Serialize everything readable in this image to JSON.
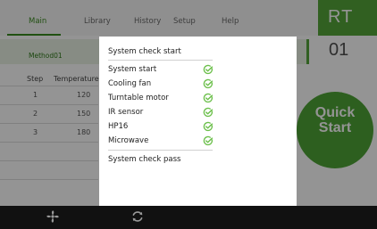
{
  "tabs": [
    {
      "label": "Main",
      "active": true
    },
    {
      "label": "Library",
      "active": false
    },
    {
      "label": "History",
      "active": false
    },
    {
      "label": "Setup",
      "active": false
    },
    {
      "label": "Help",
      "active": false
    }
  ],
  "status_panel": {
    "label": "RT"
  },
  "method": {
    "label": "Method01"
  },
  "counter": {
    "value": "01"
  },
  "table": {
    "headers": [
      "Step",
      "Temperature"
    ],
    "rows": [
      [
        "1",
        "120"
      ],
      [
        "2",
        "150"
      ],
      [
        "3",
        "180"
      ]
    ]
  },
  "quick_start": {
    "line1": "Quick",
    "line2": "Start"
  },
  "modal": {
    "title": "System check start",
    "checks": [
      {
        "label": "System start",
        "status": "ok"
      },
      {
        "label": "Cooling fan",
        "status": "ok"
      },
      {
        "label": "Turntable motor",
        "status": "ok"
      },
      {
        "label": "IR sensor",
        "status": "ok"
      },
      {
        "label": "HP16",
        "status": "ok"
      },
      {
        "label": "Microwave",
        "status": "ok"
      }
    ],
    "footer": "System check pass"
  },
  "colors": {
    "accent": "#55a63a",
    "check": "#6bbf4a",
    "bottombar": "#111111"
  },
  "bottom_icons": [
    "fan-icon",
    "refresh-icon"
  ]
}
